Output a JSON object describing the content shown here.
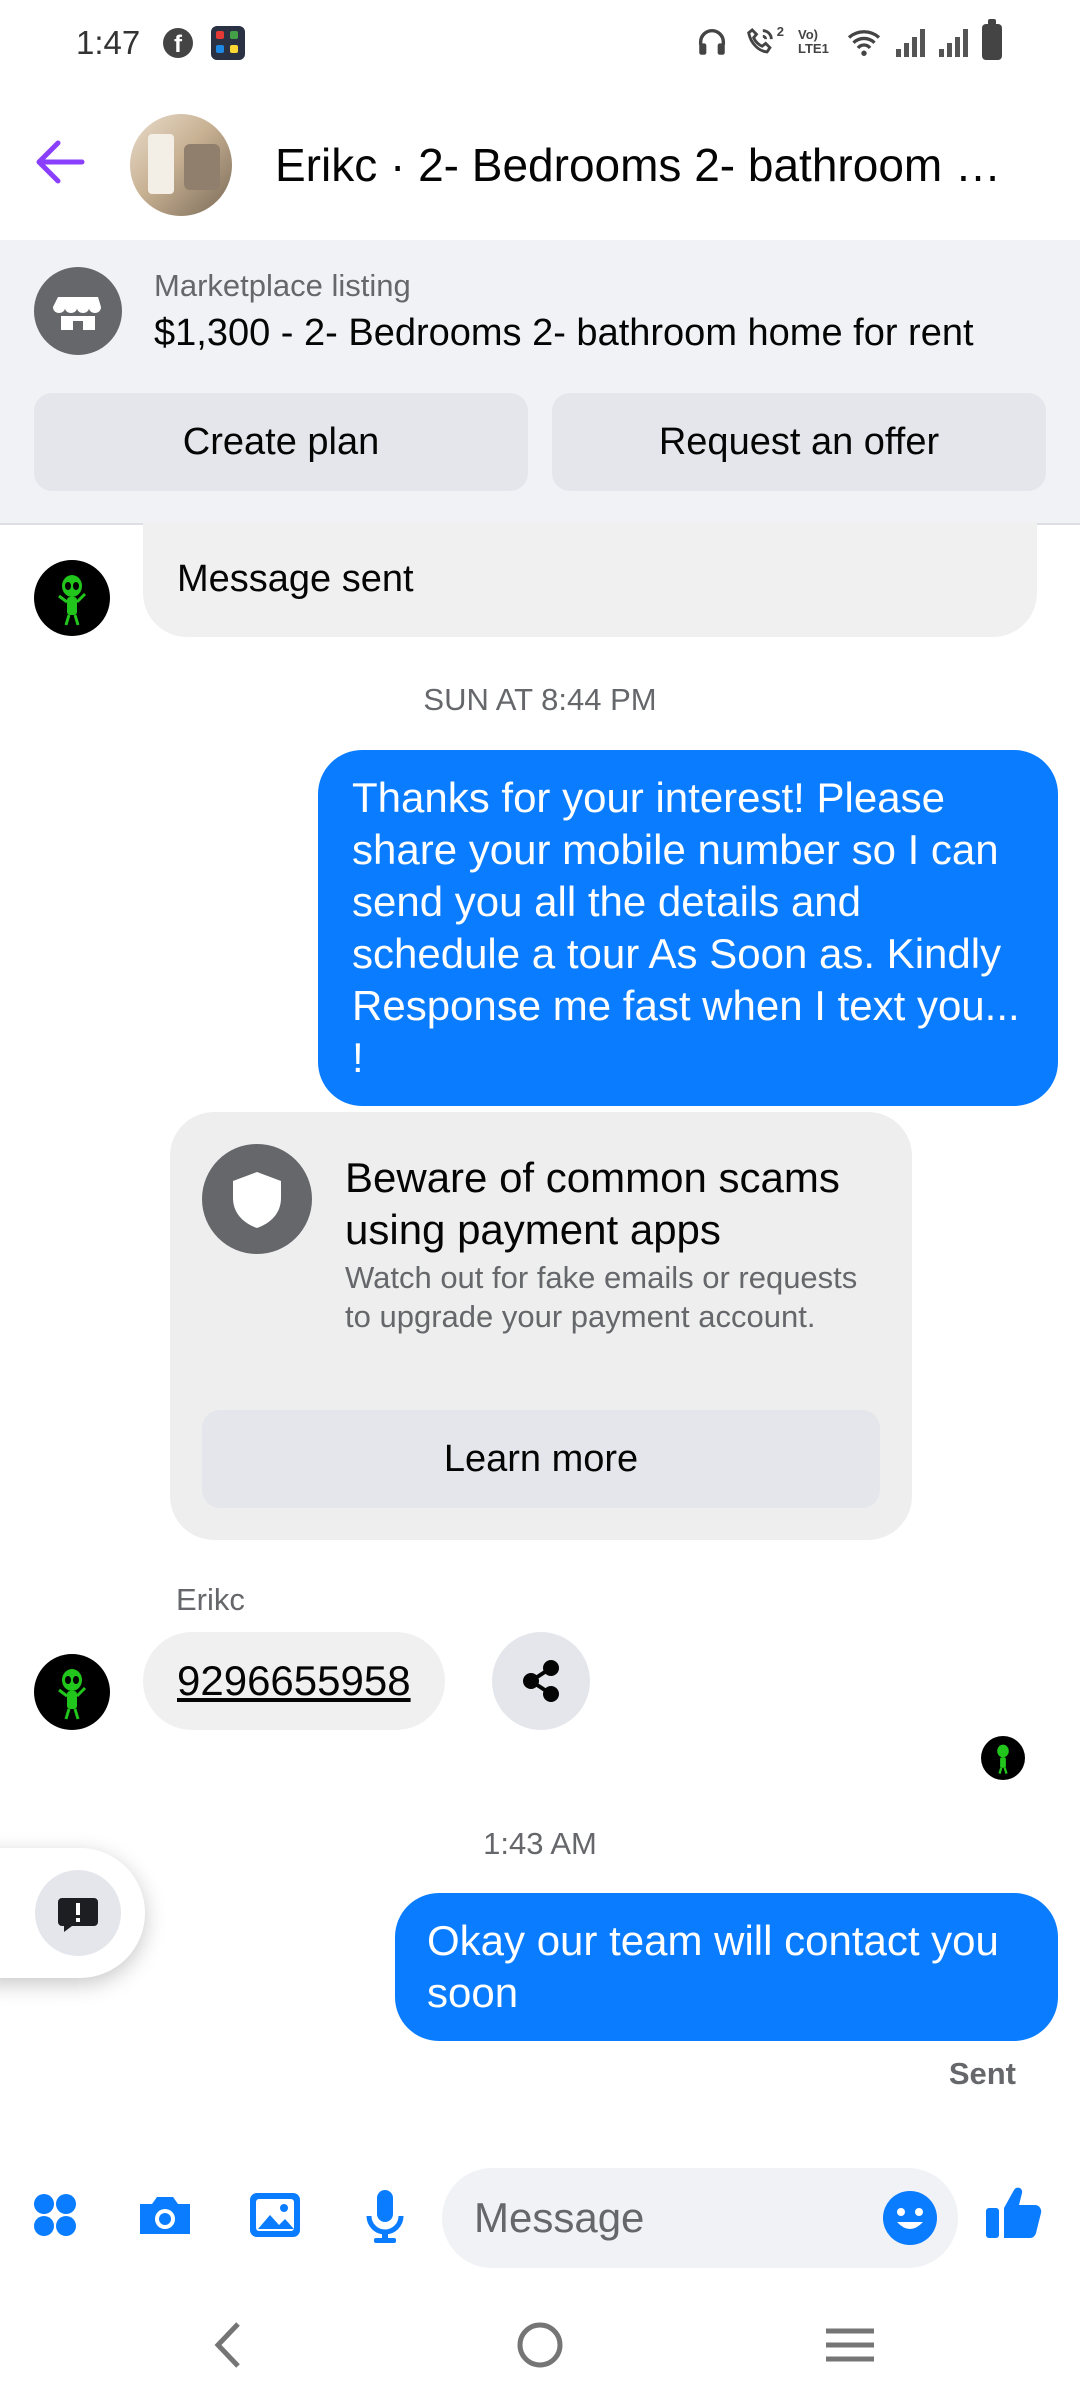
{
  "status_bar": {
    "time": "1:47",
    "network_label": "Vo) LTE1",
    "sim_badge": "2"
  },
  "header": {
    "title": "Erikc · 2- Bedrooms 2- bathroom home for rent"
  },
  "listing": {
    "label": "Marketplace listing",
    "title": "$1,300 - 2- Bedrooms 2- bathroom home for rent",
    "create_plan": "Create plan",
    "request_offer": "Request an offer"
  },
  "messages": {
    "message_sent": "Message sent",
    "time_1": "SUN AT 8:44 PM",
    "outgoing_1": "Thanks for your interest! Please share your mobile number so I can send you all the details and schedule a tour As Soon as. Kindly Response me fast when I text you... !",
    "scam_title": "Beware of common scams using payment apps",
    "scam_body": "Watch out for fake emails or requests to upgrade your payment account.",
    "learn_more": "Learn more",
    "sender": "Erikc",
    "phone": "9296655958",
    "time_2": "1:43 AM",
    "outgoing_2": "Okay our team will contact you soon",
    "status": "Sent"
  },
  "composer": {
    "placeholder": "Message"
  },
  "colors": {
    "accent_blue": "#0a7cff",
    "back_arrow": "#8a3ffc",
    "bubble_gray": "#f0f0f0",
    "panel_gray": "#f0f2f5",
    "alien_green": "#22c51c"
  }
}
